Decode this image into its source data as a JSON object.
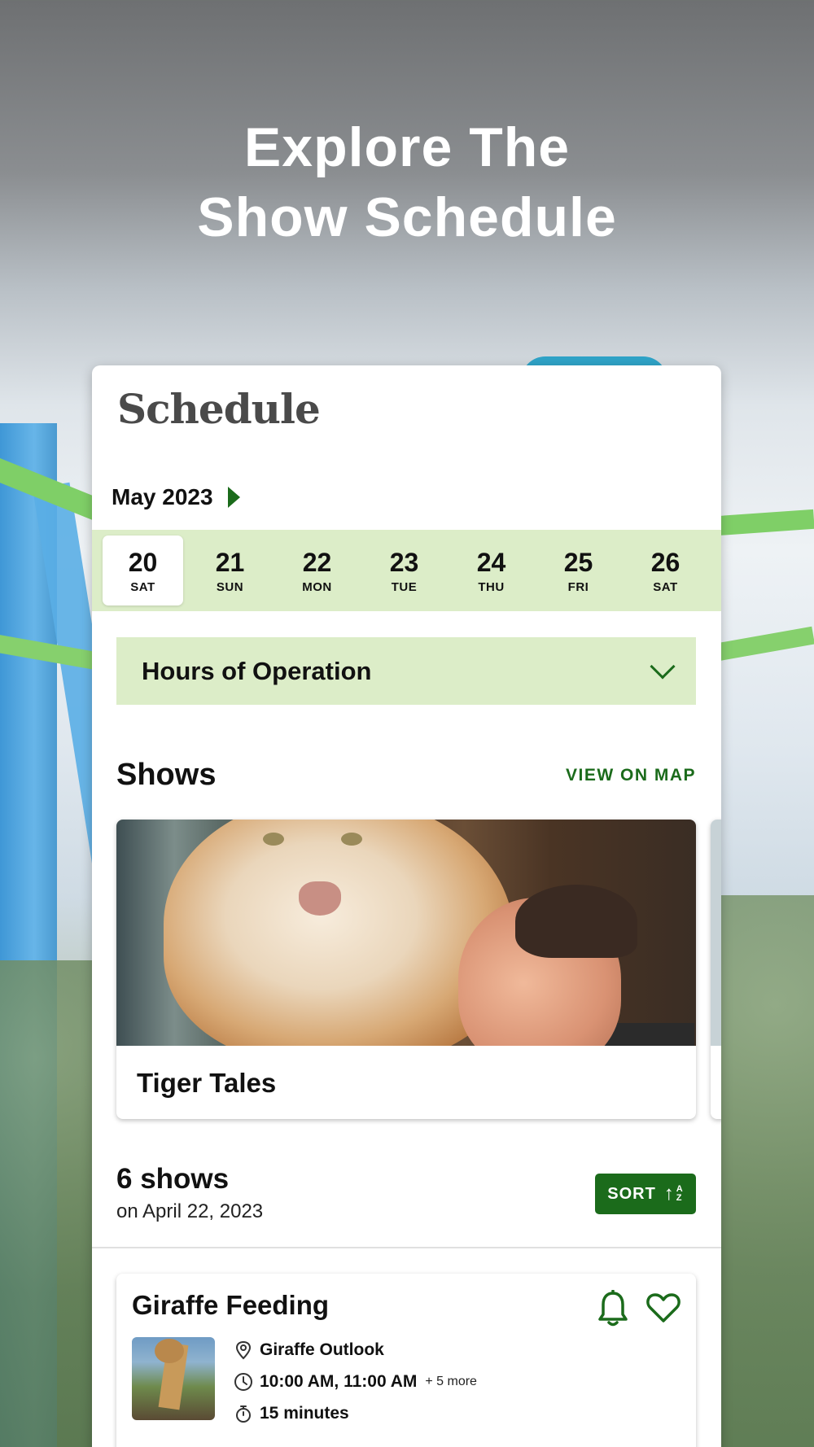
{
  "headline": {
    "line1": "Explore The",
    "line2": "Show Schedule"
  },
  "schedule": {
    "title": "Schedule",
    "month": "May 2023",
    "days": [
      {
        "num": "20",
        "name": "SAT",
        "selected": true
      },
      {
        "num": "21",
        "name": "SUN"
      },
      {
        "num": "22",
        "name": "MON"
      },
      {
        "num": "23",
        "name": "TUE"
      },
      {
        "num": "24",
        "name": "THU"
      },
      {
        "num": "25",
        "name": "FRI"
      },
      {
        "num": "26",
        "name": "SAT"
      }
    ],
    "hours_label": "Hours of Operation"
  },
  "shows": {
    "title": "Shows",
    "view_on_map": "VIEW ON MAP",
    "featured": [
      {
        "name": "Tiger Tales"
      }
    ]
  },
  "listing": {
    "count": "6 shows",
    "date": "on April 22, 2023",
    "sort_label": "SORT"
  },
  "events": [
    {
      "title": "Giraffe Feeding",
      "location": "Giraffe Outlook",
      "times": "10:00 AM, 11:00 AM",
      "more": "+ 5 more",
      "duration": "15 minutes"
    }
  ],
  "colors": {
    "accent": "#1b6b1b",
    "light_green": "#dcedc8"
  },
  "icons": [
    "chevron-right-icon",
    "chevron-down-icon",
    "sort-az-icon",
    "bell-icon",
    "heart-icon",
    "location-pin-icon",
    "clock-icon",
    "stopwatch-icon"
  ]
}
